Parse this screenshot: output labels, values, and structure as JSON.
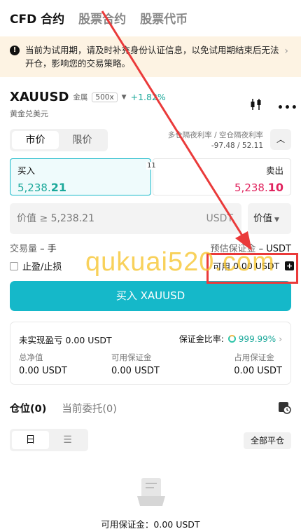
{
  "top_tabs": [
    "CFD 合约",
    "股票合约",
    "股票代币"
  ],
  "notice": {
    "text": "当前为试用期，请及时补充身份认证信息，以免试用期结束后无法开仓，影响您的交易策略。"
  },
  "symbol": {
    "name": "XAUUSD",
    "tag": "金属",
    "leverage": "500x",
    "change": "+1.82%",
    "subtitle": "黄金兑美元"
  },
  "order_type": {
    "market": "市价",
    "limit": "限价"
  },
  "overnight": {
    "label": "多仓隔夜利率 / 空仓隔夜利率",
    "value": "-97.48 / 52.11"
  },
  "quote": {
    "buy_label": "买入",
    "buy_price": "5,238.21",
    "sell_label": "卖出",
    "sell_price": "5,238.10",
    "spread": "11"
  },
  "value_input": {
    "placeholder": "价值 ≥ 5,238.21",
    "unit": "USDT",
    "type": "价值"
  },
  "quantity": {
    "label": "交易量",
    "value": "– 手"
  },
  "margin": {
    "label": "预估保证金",
    "value": "– USDT"
  },
  "tpsl_label": "止盈/止损",
  "available": {
    "label": "可用",
    "value": "0.00 USDT"
  },
  "buy_button": "买入 XAUUSD",
  "account": {
    "pnl_label": "未实现盈亏",
    "pnl_value": "0.00 USDT",
    "ratio_label": "保证金比率:",
    "ratio_value": "999.99%",
    "equity_label": "总净值",
    "equity_value": "0.00 USDT",
    "avail_margin_label": "可用保证金",
    "avail_margin_value": "0.00 USDT",
    "used_margin_label": "占用保证金",
    "used_margin_value": "0.00 USDT"
  },
  "position_tabs": [
    "仓位(0)",
    "当前委托(0)"
  ],
  "close_all": "全部平仓",
  "bottom_note": "可用保证金：0.00 USDT",
  "watermark": "qukuai520.com",
  "colors": {
    "accent": "#15b8c9",
    "up": "#1ba89a",
    "down": "#e0245e",
    "annotation": "#ea3a3a",
    "watermark": "#f6c42d"
  },
  "icons": [
    "warning-icon",
    "chevron-right-icon",
    "candlestick-icon",
    "more-icon",
    "chevron-up-icon",
    "dropdown-icon",
    "plus-icon",
    "history-icon",
    "calendar-view-icon",
    "list-view-icon",
    "empty-document-icon"
  ]
}
